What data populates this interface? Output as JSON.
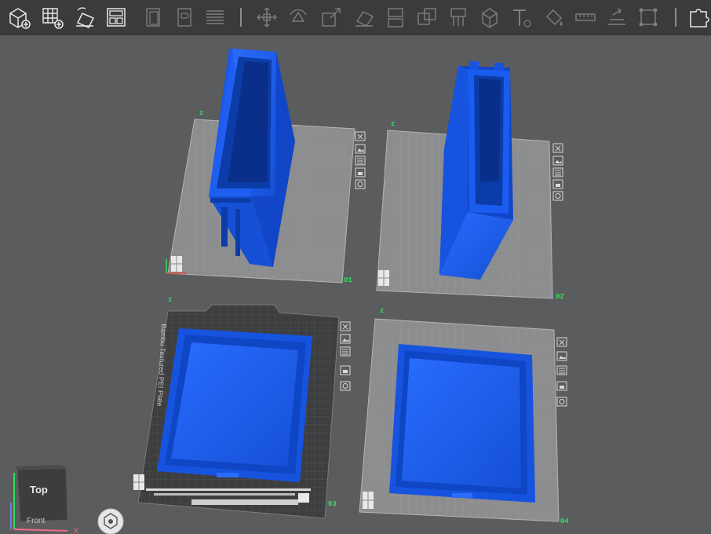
{
  "toolbar": {
    "tools": [
      {
        "name": "add-part-icon",
        "enabled": true
      },
      {
        "name": "add-plate-icon",
        "enabled": true
      },
      {
        "name": "auto-orient-icon",
        "enabled": true
      },
      {
        "name": "arrange-icon",
        "enabled": true
      },
      {
        "name": "split-objects-icon",
        "enabled": false
      },
      {
        "name": "split-parts-icon",
        "enabled": false
      },
      {
        "name": "layers-icon",
        "enabled": false
      },
      {
        "name": "move-icon",
        "enabled": false
      },
      {
        "name": "rotate-icon",
        "enabled": false
      },
      {
        "name": "scale-icon",
        "enabled": false
      },
      {
        "name": "lay-on-face-icon",
        "enabled": false
      },
      {
        "name": "cut-icon",
        "enabled": false
      },
      {
        "name": "boolean-icon",
        "enabled": false
      },
      {
        "name": "support-paint-icon",
        "enabled": false
      },
      {
        "name": "seam-paint-icon",
        "enabled": false
      },
      {
        "name": "text-icon",
        "enabled": false
      },
      {
        "name": "color-paint-icon",
        "enabled": false
      },
      {
        "name": "measure-icon",
        "enabled": false
      },
      {
        "name": "assembly-icon",
        "enabled": false
      },
      {
        "name": "variable-layer-icon",
        "enabled": false
      },
      {
        "name": "puzzle-icon",
        "enabled": true
      }
    ]
  },
  "plates": [
    {
      "id": "01",
      "label": "01",
      "textured": false
    },
    {
      "id": "02",
      "label": "02",
      "textured": false
    },
    {
      "id": "03",
      "label": "03",
      "textured": true,
      "plate_text": "Bambu Textured PEI Plate"
    },
    {
      "id": "04",
      "label": "04",
      "textured": false
    }
  ],
  "plate_tools": [
    "close-plate-icon",
    "plate-image-icon",
    "plate-settings-icon",
    "plate-lock-icon",
    "plate-autoorient-icon"
  ],
  "view_cube": {
    "face_label": "Top",
    "front_label": "Front",
    "axis_x": "X"
  },
  "colors": {
    "model": "#1b5ef2",
    "model_dark": "#0c3ca8",
    "background": "#5b5c5e",
    "toolbar": "#3a3b3d",
    "plate_label": "#2ee05a"
  }
}
